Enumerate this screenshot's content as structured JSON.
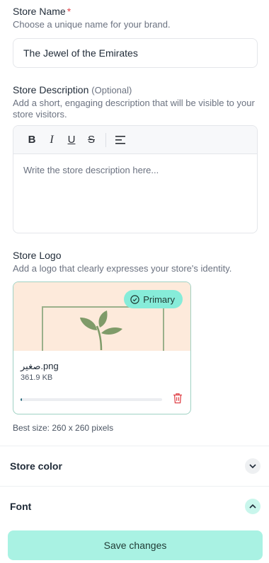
{
  "store_name": {
    "label": "Store Name",
    "required_mark": "*",
    "hint": "Choose a unique name for your brand.",
    "value": "The Jewel of the Emirates"
  },
  "store_description": {
    "label": "Store Description",
    "optional_tag": "(Optional)",
    "hint": "Add a short, engaging description that will be visible to your store visitors.",
    "placeholder": "Write the store description here...",
    "toolbar": {
      "bold": "B",
      "italic": "I",
      "underline": "U",
      "strike": "S"
    }
  },
  "store_logo": {
    "label": "Store Logo",
    "hint": "Add a logo that clearly expresses your store's identity.",
    "badge": "Primary",
    "file_name": "صغير.png",
    "file_size": "361.9 KB",
    "upload_progress": 0.01,
    "best_size": "Best size: 260 x 260 pixels"
  },
  "accordions": {
    "store_color": {
      "title": "Store color",
      "state": "collapsed"
    },
    "font": {
      "title": "Font",
      "state": "expanded"
    }
  },
  "footer": {
    "save_label": "Save changes"
  },
  "colors": {
    "accent": "#86ecd9",
    "save_button": "#a9f2e3",
    "required": "#e0454b",
    "logo_bg": "#fdeadb",
    "card_border": "#9fd1c3",
    "delete": "#e0454b"
  },
  "icons": [
    "check-circle-icon",
    "trash-icon",
    "chevron-down-icon",
    "chevron-up-icon",
    "align-left-icon",
    "leaf-icon"
  ]
}
